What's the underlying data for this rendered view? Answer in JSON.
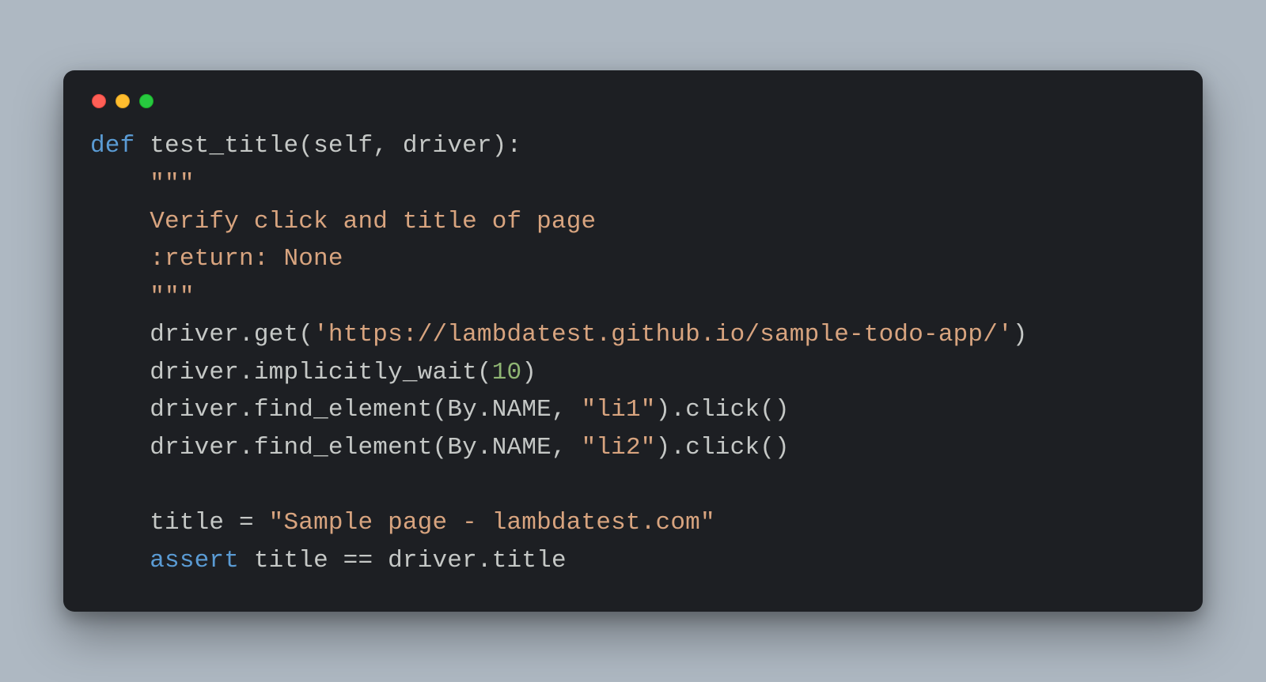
{
  "code": {
    "kw_def": "def",
    "fn_name": "test_title",
    "params_open": "(",
    "param_self": "self",
    "comma_sp": ", ",
    "param_driver": "driver",
    "params_close": "):",
    "indent1": "    ",
    "doc_open": "\"\"\"",
    "doc_line1": "Verify click and title of page",
    "doc_line2": ":return: None",
    "doc_close": "\"\"\"",
    "l_driver": "driver",
    "dot": ".",
    "m_get": "get",
    "open_p": "(",
    "close_p": ")",
    "url_str": "'https://lambdatest.github.io/sample-todo-app/'",
    "m_imp": "implicitly_wait",
    "num_10": "10",
    "m_find": "find_element",
    "by_name": "By",
    "attr_name": "NAME",
    "li1_str": "\"li1\"",
    "li2_str": "\"li2\"",
    "m_click": "click",
    "empty_pp": "()",
    "title_id": "title",
    "eq": " = ",
    "title_str": "\"Sample page - lambdatest.com\"",
    "kw_assert": "assert",
    "sp": " ",
    "eqeq": " == ",
    "attr_title": "title"
  }
}
